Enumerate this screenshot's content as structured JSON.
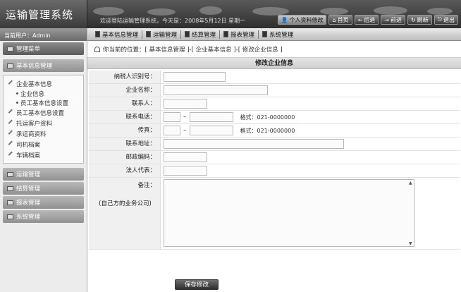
{
  "app": {
    "title": "运输管理系统",
    "welcome": "欢迎登陆运输管理系统，今天是：2008年5月12日 星期一"
  },
  "top_nav": [
    {
      "label": "个人资料修改",
      "icon": "user-icon"
    },
    {
      "label": "首页",
      "icon": "home-icon"
    },
    {
      "label": "后退",
      "icon": "back-icon"
    },
    {
      "label": "前进",
      "icon": "forward-icon"
    },
    {
      "label": "刷新",
      "icon": "refresh-icon"
    },
    {
      "label": "退出",
      "icon": "exit-icon"
    }
  ],
  "modules": [
    "基本信息管理",
    "运输管理",
    "结算管理",
    "报表管理",
    "系统管理"
  ],
  "sidebar": {
    "user_label": "当前用户：Admin",
    "menu_title": "管理菜单",
    "section": "基本信息管理",
    "items": [
      {
        "label": "企业基本信息",
        "children": [
          "企业信息",
          "员工基本信息设置"
        ]
      },
      {
        "label": "员工基本信息设置"
      },
      {
        "label": "托运客户资料"
      },
      {
        "label": "承运商资料"
      },
      {
        "label": "司机档案"
      },
      {
        "label": "车辆档案"
      }
    ],
    "groups": [
      "运输管理",
      "结算管理",
      "报表管理",
      "系统管理"
    ]
  },
  "breadcrumb": "你当前的位置：[ 基本信息管理 ]-[ 企业基本信息 ]-[ 修改企业信息 ]",
  "form": {
    "title": "修改企业信息",
    "fields": {
      "tax_id": "纳税人识别号：",
      "company": "企业名称：",
      "contact": "联系人：",
      "phone": "联系电话：",
      "fax": "传真：",
      "address": "联系地址：",
      "zip": "邮政编码：",
      "legal": "法人代表：",
      "remark": "备注：",
      "remark_sub": "(自己方的业务公司)"
    },
    "phone_hint": "格式：021-0000000",
    "fax_hint": "格式：021-0000000",
    "save": "保存修改"
  }
}
